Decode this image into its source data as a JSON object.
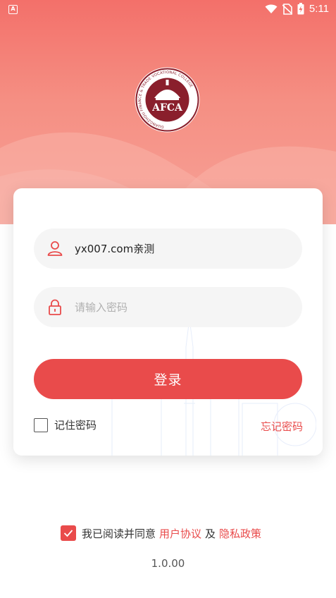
{
  "status_bar": {
    "time": "5:11",
    "left_icon": "A",
    "icons": [
      "wifi-icon",
      "no-sim-icon",
      "battery-charging-icon"
    ]
  },
  "header": {
    "logo_text": "AFCA",
    "logo_ring_text": "GUANGZHOU FINANCE & TRADE VOCATIONAL COLLEGE"
  },
  "login_form": {
    "username_value": "yx007.com亲测",
    "password_placeholder": "请输入密码",
    "login_label": "登录",
    "remember_label": "记住密码",
    "remember_checked": false,
    "forgot_label": "忘记密码"
  },
  "agreement": {
    "checked": true,
    "prefix": "我已阅读并同意",
    "user_agreement": "用户协议",
    "joiner": "及",
    "privacy_policy": "隐私政策"
  },
  "version": "1.0.00",
  "colors": {
    "accent": "#e94b4b",
    "header_top": "#f3706a",
    "header_bottom": "#f7a197"
  }
}
